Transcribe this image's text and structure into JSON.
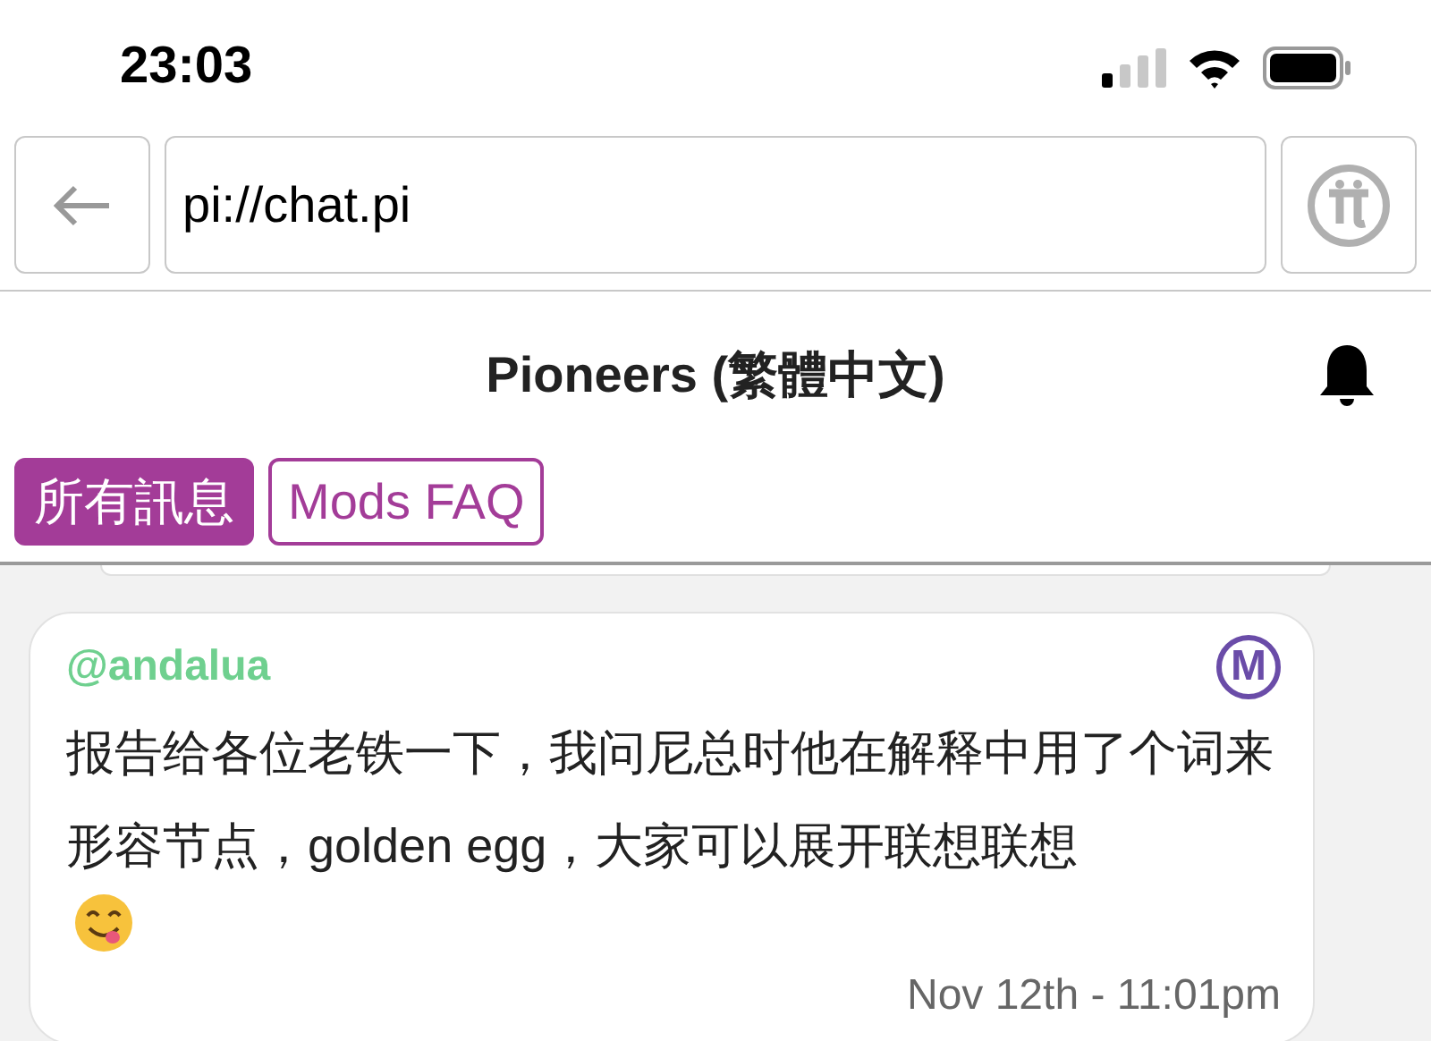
{
  "status_bar": {
    "time": "23:03"
  },
  "address_bar": {
    "url": "pi://chat.pi"
  },
  "header": {
    "title": "Pioneers (繁體中文)"
  },
  "tabs": [
    {
      "label": "所有訊息",
      "selected": true
    },
    {
      "label": "Mods FAQ",
      "selected": false
    }
  ],
  "messages": [
    {
      "author": "@andalua",
      "badge": "M",
      "text": "报告给各位老铁一下，我问尼总时他在解释中用了个词来形容节点，golden egg，大家可以展开联想联想",
      "time": "Nov 12th - 11:01pm"
    }
  ]
}
